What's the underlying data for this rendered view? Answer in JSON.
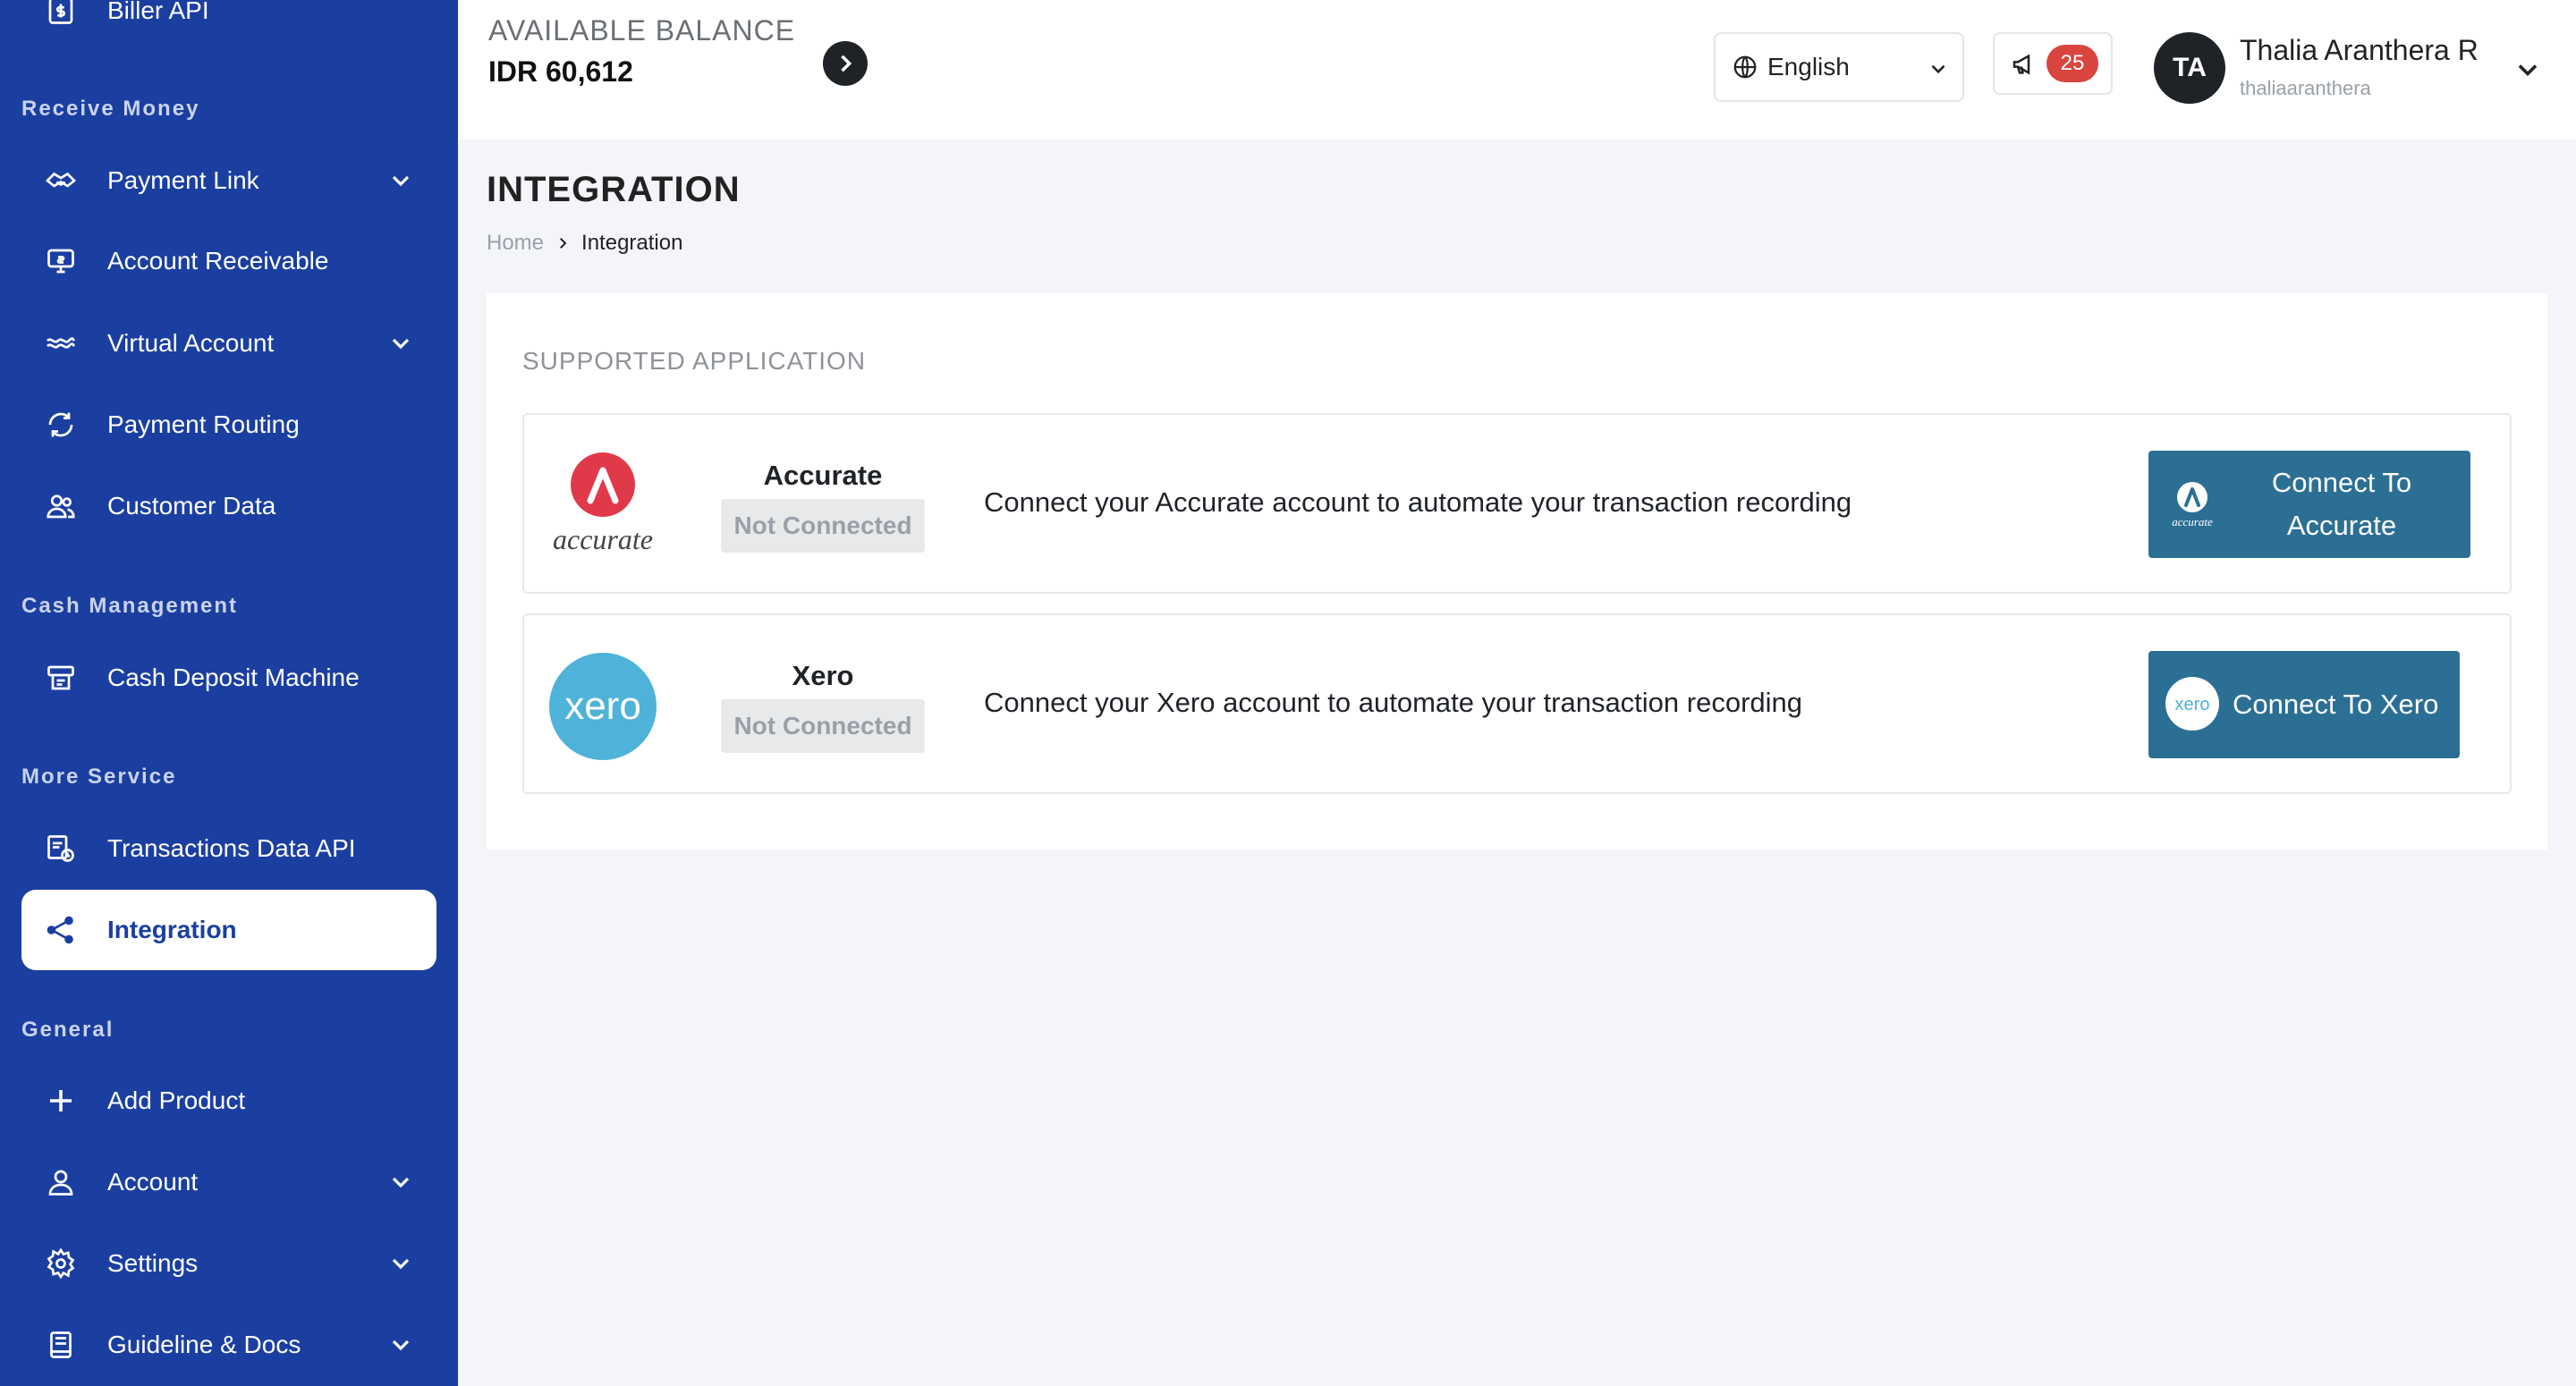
{
  "sidebar": {
    "top_item": "Biller API",
    "sections": {
      "receive_money": "Receive Money",
      "cash_management": "Cash Management",
      "more_service": "More Service",
      "general": "General"
    },
    "items": {
      "payment_link": "Payment Link",
      "account_receivable": "Account Receivable",
      "virtual_account": "Virtual Account",
      "payment_routing": "Payment Routing",
      "customer_data": "Customer Data",
      "cash_deposit_machine": "Cash Deposit Machine",
      "transactions_data_api": "Transactions Data API",
      "integration": "Integration",
      "add_product": "Add Product",
      "account": "Account",
      "settings": "Settings",
      "guideline_docs": "Guideline & Docs"
    },
    "active_item": "integration"
  },
  "topbar": {
    "balance_label": "AVAILABLE BALANCE",
    "balance_value": "IDR 60,612",
    "language": "English",
    "notification_count": "25",
    "user_initials": "TA",
    "user_name": "Thalia Aranthera R",
    "user_handle": "thaliaaranthera"
  },
  "page": {
    "title": "INTEGRATION",
    "breadcrumb": {
      "home": "Home",
      "current": "Integration"
    }
  },
  "integration": {
    "section_title": "SUPPORTED APPLICATION",
    "apps": [
      {
        "name": "Accurate",
        "logo_text": "accurate",
        "status": "Not Connected",
        "description": "Connect your Accurate account to automate your transaction recording",
        "button_line1": "Connect To",
        "button_line2": "Accurate"
      },
      {
        "name": "Xero",
        "logo_text": "xero",
        "status": "Not Connected",
        "description": "Connect your Xero account to automate your transaction recording",
        "button_label": "Connect To Xero"
      }
    ]
  },
  "colors": {
    "sidebar_bg": "#1b3fa0",
    "button_bg": "#2c6f94",
    "badge_bg": "#d9443f",
    "accurate_red": "#e03a4a",
    "xero_blue": "#4fb3d9"
  }
}
